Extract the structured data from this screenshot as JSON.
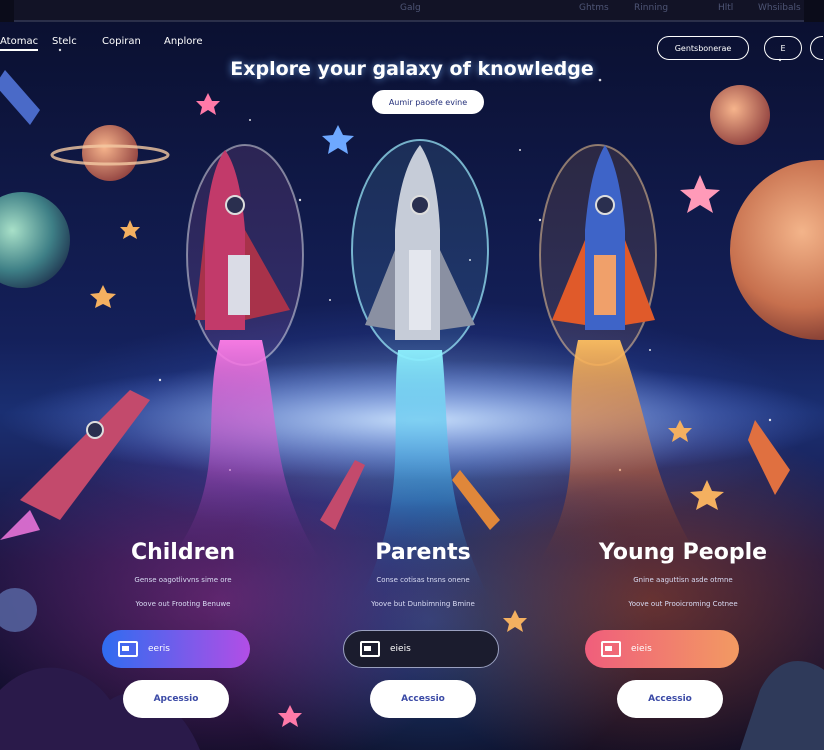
{
  "topbar": {
    "items": [
      "Galg",
      "Ghtms",
      "Rinning",
      "Hltl",
      "Whsiibals"
    ]
  },
  "nav": {
    "links": [
      "Atomac",
      "Stelc",
      "Copiran",
      "Anplore"
    ],
    "right_button": "Gentsbonerae",
    "small_button": "E",
    "corner_button": ""
  },
  "hero": {
    "title": "Explore your galaxy of knowledge",
    "cta": "Aumir paoefe evine"
  },
  "columns": [
    {
      "title": "Children",
      "line1": "Gense oagotlivvns sime ore",
      "line2": "Yoove out  Frooting Benuwe",
      "bar_label": "eeris",
      "access_label": "Apcessio"
    },
    {
      "title": "Parents",
      "line1": "Conse cotisas tnsns  onene",
      "line2": "Yoove but  Dunbimning Bmine",
      "bar_label": "eieis",
      "access_label": "Accessio"
    },
    {
      "title": "Young People",
      "line1": "Gnine aaguttisn asde otmne",
      "line2": "Yoove out  Prooicroming Cotnee",
      "bar_label": "eieis",
      "access_label": "Accessio"
    }
  ],
  "colors": {
    "children_gradient": [
      "#2f6cf0",
      "#b24ee6"
    ],
    "parents_bar": "#1b1c2e",
    "young_gradient": [
      "#f05e7c",
      "#f29a62"
    ],
    "children_trail": "#e05ad2",
    "parents_trail": "#4ad4f5",
    "young_trail": "#f2893a"
  },
  "icons": [
    "rocket-icon",
    "planet-icon",
    "star-icon",
    "card-icon"
  ]
}
